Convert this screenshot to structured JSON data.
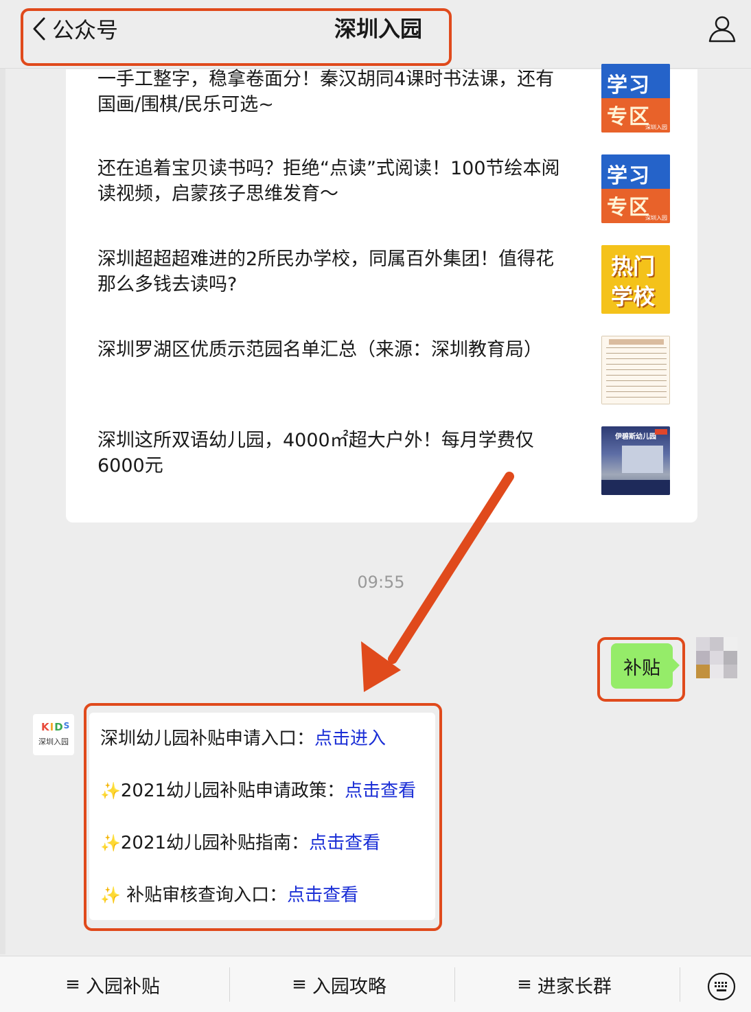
{
  "header": {
    "back_label": "公众号",
    "title": "深圳入园"
  },
  "articles": [
    {
      "title": "一手工整字，稳拿卷面分！秦汉胡同4课时书法课，还有国画/围棋/民乐可选~",
      "thumb_line1": "学习",
      "thumb_line2": "专区",
      "thumb_mini": "深圳入园"
    },
    {
      "title": "还在追着宝贝读书吗？拒绝“点读”式阅读！100节绘本阅读视频，启蒙孩子思维发育～",
      "thumb_line1": "学习",
      "thumb_line2": "专区",
      "thumb_mini": "深圳入园"
    },
    {
      "title": "深圳超超超难进的2所民办学校，同属百外集团！值得花那么多钱去读吗?",
      "thumb_line1": "热门",
      "thumb_line2": "学校"
    },
    {
      "title": "深圳罗湖区优质示范园名单汇总（来源：深圳教育局）"
    },
    {
      "title": "深圳这所双语幼儿园，4000㎡超大户外！每月学费仅6000元",
      "thumb_caption": "伊碧斯幼儿园"
    }
  ],
  "chat": {
    "timestamp": "09:55",
    "my_message": "补贴",
    "bot_avatar": {
      "logo_k": "K",
      "logo_i": "I",
      "logo_d": "D",
      "logo_s": "S",
      "name": "深圳入园"
    },
    "reply_lines": [
      {
        "prefix": "",
        "text": "深圳幼儿园补贴申请入口：",
        "link": "点击进入"
      },
      {
        "prefix": "✨",
        "text": "2021幼儿园补贴申请政策：",
        "link": "点击查看"
      },
      {
        "prefix": "✨",
        "text": "2021幼儿园补贴指南：",
        "link": "点击查看"
      },
      {
        "prefix": "✨",
        "text": " 补贴审核查询入口：",
        "link": "点击查看"
      }
    ]
  },
  "bottom_menu": {
    "items": [
      {
        "icon": "≡",
        "label": "入园补贴"
      },
      {
        "icon": "≡",
        "label": "入园攻略"
      },
      {
        "icon": "≡",
        "label": "进家长群"
      }
    ],
    "keyboard_icon": "keyboard-icon"
  },
  "colors": {
    "highlight": "#e04a1c",
    "my_bubble": "#95ec69",
    "link": "#1a2ed6",
    "background": "#ededed"
  }
}
